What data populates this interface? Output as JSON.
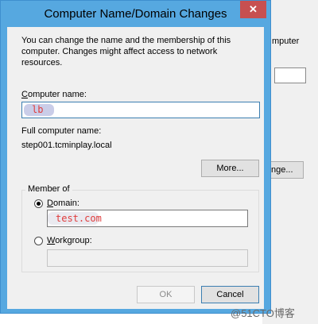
{
  "background_window": {
    "partial_text": "mputer",
    "button_label": "nge..."
  },
  "dialog": {
    "title": "Computer Name/Domain Changes",
    "close_symbol": "✕",
    "description": "You can change the name and the membership of this computer. Changes might affect access to network resources.",
    "computer_name_label_prefix": "",
    "computer_name_label_underlined": "C",
    "computer_name_label_rest": "omputer name:",
    "computer_name_value": "lb",
    "full_name_label": "Full computer name:",
    "full_name_value": "step001.tcminplay.local",
    "more_button": "More...",
    "member_of_legend": "Member of",
    "domain_label_underlined": "D",
    "domain_label_rest": "omain:",
    "domain_value": "test.com",
    "workgroup_label_underlined": "W",
    "workgroup_label_rest": "orkgroup:",
    "workgroup_value": "",
    "ok_button": "OK",
    "cancel_button": "Cancel"
  },
  "watermark": "@51CTO博客"
}
